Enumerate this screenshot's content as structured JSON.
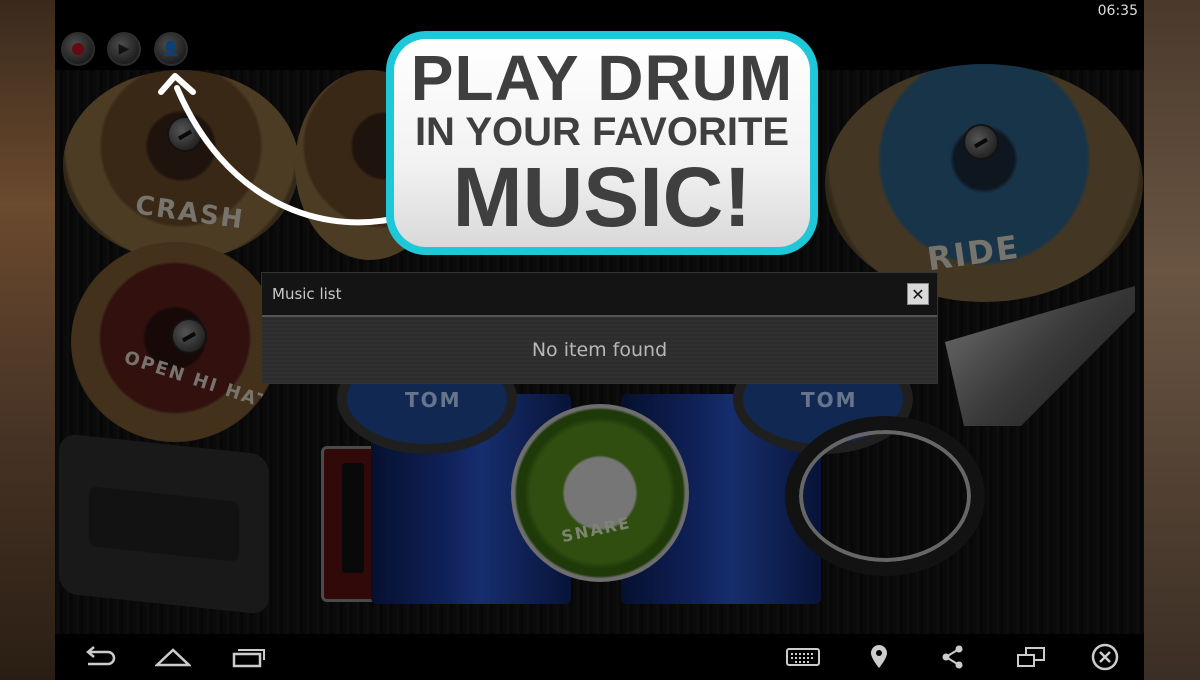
{
  "status_bar": {
    "time": "06:35"
  },
  "controls": [
    {
      "name": "record-button",
      "icon": "record-icon"
    },
    {
      "name": "play-button",
      "icon": "play-icon"
    },
    {
      "name": "music-list-button",
      "icon": "user-icon"
    }
  ],
  "kit": {
    "crash_label": "CRASH",
    "open_hihat_label": "OPEN HI HAT",
    "ride_label": "RIDE",
    "tom_left_label": "TOM",
    "tom_right_label": "TOM",
    "snare_label": "SNARE"
  },
  "promo": {
    "line1": "PLAY DRUM",
    "line2": "IN YOUR FAVORITE",
    "line3": "MUSIC!",
    "border_color": "#1ec8d8"
  },
  "dialog": {
    "title": "Music list",
    "close_label": "✕",
    "empty_text": "No item found"
  },
  "nav_bar": {
    "left": [
      "back-icon",
      "home-icon",
      "recent-apps-icon"
    ],
    "right": [
      "keyboard-icon",
      "location-icon",
      "share-icon",
      "window-icon",
      "close-circle-icon"
    ]
  }
}
